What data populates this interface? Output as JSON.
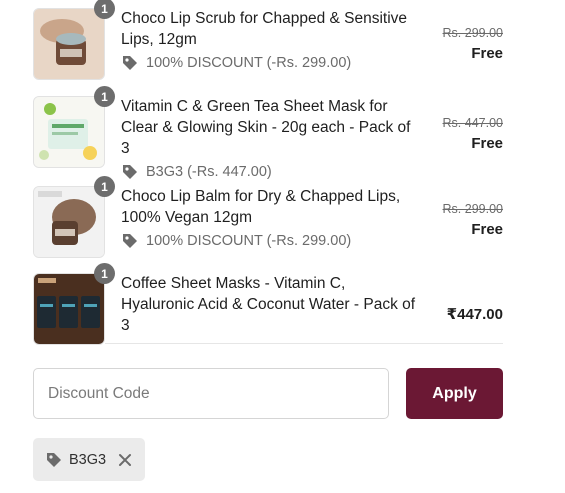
{
  "items": [
    {
      "quantity": "1",
      "name": "Choco Lip Scrub for Chapped & Sensitive Lips, 12gm",
      "discount": "100% DISCOUNT (-Rs. 299.00)",
      "original_price": "Rs. 299.00",
      "final_price": "Free",
      "thumb_icon": "lip-scrub-jar-icon"
    },
    {
      "quantity": "1",
      "name": "Vitamin C & Green Tea Sheet Mask for Clear & Glowing Skin - 20g each - Pack of 3",
      "discount": "B3G3 (-Rs. 447.00)",
      "original_price": "Rs. 447.00",
      "final_price": "Free",
      "thumb_icon": "sheet-mask-pack-icon"
    },
    {
      "quantity": "1",
      "name": "Choco Lip Balm for Dry & Chapped Lips, 100% Vegan 12gm",
      "discount": "100% DISCOUNT (-Rs. 299.00)",
      "original_price": "Rs. 299.00",
      "final_price": "Free",
      "thumb_icon": "lip-balm-jar-icon"
    },
    {
      "quantity": "1",
      "name": "Coffee Sheet Masks - Vitamin C, Hyaluronic Acid & Coconut Water - Pack of 3",
      "final_price": "₹447.00",
      "thumb_icon": "coffee-mask-packs-icon"
    }
  ],
  "discount_form": {
    "placeholder": "Discount Code",
    "apply_label": "Apply"
  },
  "applied_code": {
    "label": "B3G3"
  },
  "colors": {
    "accent": "#6b1834",
    "badge": "#6d6d6d",
    "chip_bg": "#ebebeb"
  }
}
